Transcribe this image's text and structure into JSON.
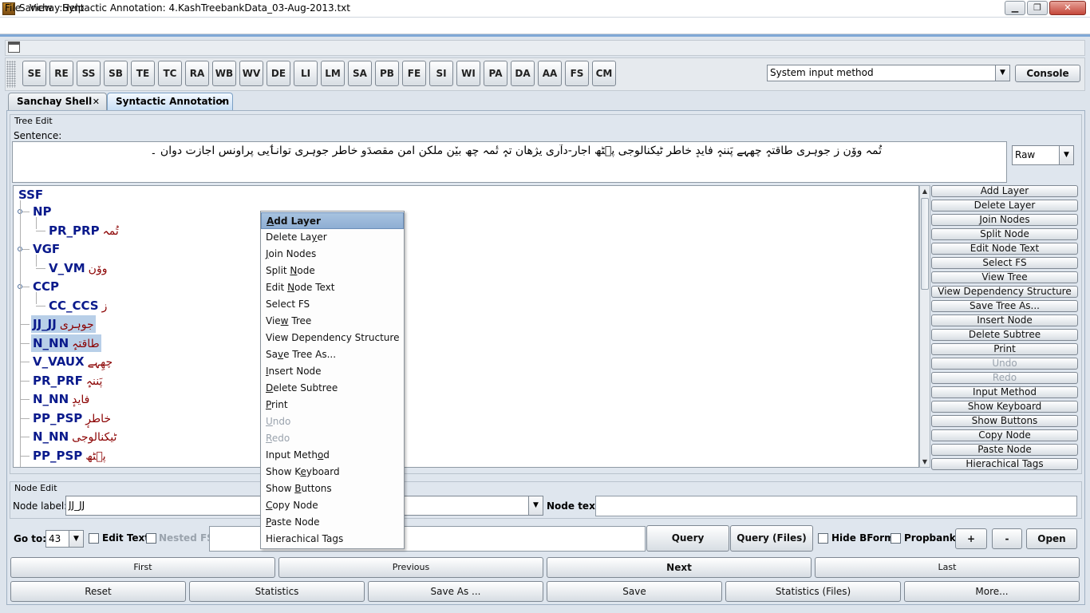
{
  "window": {
    "title": "Sanchay:Syntactic Annotation: 4.KashTreebankData_03-Aug-2013.txt",
    "min": "▁",
    "max": "❐",
    "close": "✕"
  },
  "menu": {
    "file": "File",
    "view": "View",
    "help": "Help"
  },
  "toolbar": {
    "buttons": [
      "SE",
      "RE",
      "SS",
      "SB",
      "TE",
      "TC",
      "RA",
      "WB",
      "WV",
      "DE",
      "LI",
      "LM",
      "SA",
      "PB",
      "FE",
      "SI",
      "WI",
      "PA",
      "DA",
      "AA",
      "FS",
      "CM"
    ],
    "input_method": "System input method",
    "console": "Console"
  },
  "tabs": [
    {
      "label": "Sanchay Shell",
      "close": "✕"
    },
    {
      "label": "Syntactic Annotation",
      "close": "✕"
    }
  ],
  "tree_edit": {
    "title": "Tree Edit",
    "sentence_label": "Sentence:",
    "sentence": "تُمہ ووٚن ز جوہری طاقتہٕ چھِہے پَننہٕ فایدٕ خاطرٕ ٹیکنالوجی پ۪ٹھ اجارٕ-دآری یژھان تہٕ تٔمہ چھ بیٚن ملکن امن مقصدَو خاطرٕ جوہری توانٲیی پراونس اجازت دوان ۔",
    "mode": "Raw"
  },
  "tree": {
    "root": "SSF",
    "nodes": [
      {
        "tag": "NP",
        "word": ""
      },
      {
        "tag": "PR_PRP",
        "word": "تُمہ"
      },
      {
        "tag": "VGF",
        "word": ""
      },
      {
        "tag": "V_VM",
        "word": "ووٚن"
      },
      {
        "tag": "CCP",
        "word": ""
      },
      {
        "tag": "CC_CCS",
        "word": "ز"
      },
      {
        "tag": "JJ_JJ",
        "word": "جوہری"
      },
      {
        "tag": "N_NN",
        "word": "طاقتہٕ"
      },
      {
        "tag": "V_VAUX",
        "word": "چھِہے"
      },
      {
        "tag": "PR_PRF",
        "word": "پَننہٕ"
      },
      {
        "tag": "N_NN",
        "word": "فایدٕ"
      },
      {
        "tag": "PP_PSP",
        "word": "خاطرٕ"
      },
      {
        "tag": "N_NN",
        "word": "ٹیکنالوجی"
      },
      {
        "tag": "PP_PSP",
        "word": "پ۪ٹھ"
      }
    ]
  },
  "side_buttons": [
    {
      "label": "Add Layer",
      "enabled": true
    },
    {
      "label": "Delete Layer",
      "enabled": true
    },
    {
      "label": "Join Nodes",
      "enabled": true
    },
    {
      "label": "Split Node",
      "enabled": true
    },
    {
      "label": "Edit Node Text",
      "enabled": true
    },
    {
      "label": "Select FS",
      "enabled": true
    },
    {
      "label": "View Tree",
      "enabled": true
    },
    {
      "label": "View Dependency Structure",
      "enabled": true
    },
    {
      "label": "Save Tree As...",
      "enabled": true
    },
    {
      "label": "Insert Node",
      "enabled": true
    },
    {
      "label": "Delete Subtree",
      "enabled": true
    },
    {
      "label": "Print",
      "enabled": true
    },
    {
      "label": "Undo",
      "enabled": false
    },
    {
      "label": "Redo",
      "enabled": false
    },
    {
      "label": "Input Method",
      "enabled": true
    },
    {
      "label": "Show Keyboard",
      "enabled": true
    },
    {
      "label": "Show Buttons",
      "enabled": true
    },
    {
      "label": "Copy Node",
      "enabled": true
    },
    {
      "label": "Paste Node",
      "enabled": true
    },
    {
      "label": "Hierachical Tags",
      "enabled": true
    }
  ],
  "context_menu": [
    {
      "pre": "",
      "u": "A",
      "post": "dd Layer",
      "state": "active"
    },
    {
      "pre": "Delete La",
      "u": "y",
      "post": "er",
      "state": ""
    },
    {
      "pre": "",
      "u": "J",
      "post": "oin Nodes",
      "state": ""
    },
    {
      "pre": "Split ",
      "u": "N",
      "post": "ode",
      "state": ""
    },
    {
      "pre": "Edit ",
      "u": "N",
      "post": "ode Text",
      "state": ""
    },
    {
      "pre": "Select FS",
      "u": "",
      "post": "",
      "state": ""
    },
    {
      "pre": "Vie",
      "u": "w",
      "post": " Tree",
      "state": ""
    },
    {
      "pre": "View Dependency Structure",
      "u": "",
      "post": "",
      "state": ""
    },
    {
      "pre": "Sa",
      "u": "v",
      "post": "e Tree As...",
      "state": ""
    },
    {
      "pre": "",
      "u": "I",
      "post": "nsert Node",
      "state": ""
    },
    {
      "pre": "",
      "u": "D",
      "post": "elete Subtree",
      "state": ""
    },
    {
      "pre": "",
      "u": "P",
      "post": "rint",
      "state": ""
    },
    {
      "pre": "",
      "u": "U",
      "post": "ndo",
      "state": "disabled"
    },
    {
      "pre": "",
      "u": "R",
      "post": "edo",
      "state": "disabled"
    },
    {
      "pre": "Input Meth",
      "u": "o",
      "post": "d",
      "state": ""
    },
    {
      "pre": "Show K",
      "u": "e",
      "post": "yboard",
      "state": ""
    },
    {
      "pre": "Show ",
      "u": "B",
      "post": "uttons",
      "state": ""
    },
    {
      "pre": "",
      "u": "C",
      "post": "opy Node",
      "state": ""
    },
    {
      "pre": "",
      "u": "P",
      "post": "aste Node",
      "state": ""
    },
    {
      "pre": "Hierachical Tags",
      "u": "",
      "post": "",
      "state": ""
    }
  ],
  "node_edit": {
    "title": "Node Edit",
    "label_caption": "Node label:",
    "label_value": "JJ_JJ",
    "text_caption": "Node text:",
    "text_value": ""
  },
  "controls": {
    "goto_label": "Go to:",
    "goto_value": "43",
    "edit_text": "Edit Text",
    "nested_fs": "Nested FS",
    "query": "Query",
    "query_files": "Query (Files)",
    "hide_bform": "Hide BForm",
    "propbank": "Propbank",
    "plus": "+",
    "minus": "-",
    "open": "Open"
  },
  "nav": {
    "first": "First",
    "previous": "Previous",
    "next": "Next",
    "last": "Last"
  },
  "actions": {
    "reset": "Reset",
    "statistics": "Statistics",
    "save_as": "Save As ...",
    "save": "Save",
    "statistics_files": "Statistics (Files)",
    "more": "More..."
  },
  "colors": {
    "frame_accent": "#7fa8d6",
    "tag_color": "#0a1a8c",
    "word_color": "#8b0000",
    "selection": "#b8cfe8"
  }
}
